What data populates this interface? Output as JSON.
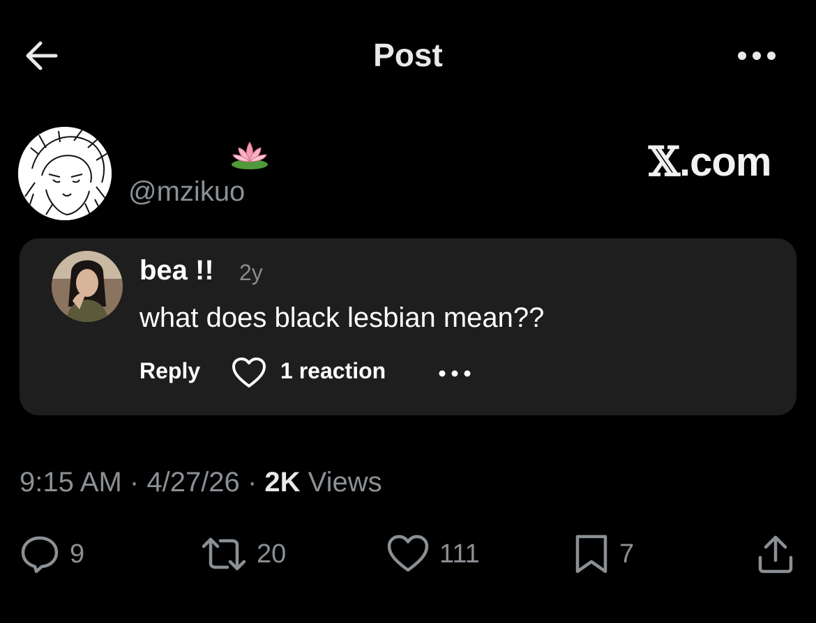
{
  "header": {
    "title": "Post",
    "back_icon": "arrow-left-icon",
    "more_icon": "more-horizontal-icon"
  },
  "author": {
    "handle": "@mzikuo",
    "display_emoji": "🪷",
    "avatar_icon": "anime-sketch-avatar"
  },
  "watermark": {
    "x": "𝕏",
    "suffix": ".com"
  },
  "comment_card": {
    "name": "bea !!",
    "time": "2y",
    "text": "what does black lesbian mean??",
    "reply_label": "Reply",
    "reactions_label": "1 reaction",
    "heart_icon": "heart-outline-icon",
    "more_icon": "more-horizontal-icon"
  },
  "meta": {
    "time": "9:15 AM",
    "sep1": "·",
    "date": "4/27/26",
    "sep2": "·",
    "views_count": "2K",
    "views_label": "Views"
  },
  "actions": {
    "replies": "9",
    "reposts": "20",
    "likes": "111",
    "bookmarks": "7"
  },
  "colors": {
    "background": "#000000",
    "card": "#1e1e1e",
    "text_primary": "#e7e9ea",
    "text_secondary": "#8b9095"
  }
}
